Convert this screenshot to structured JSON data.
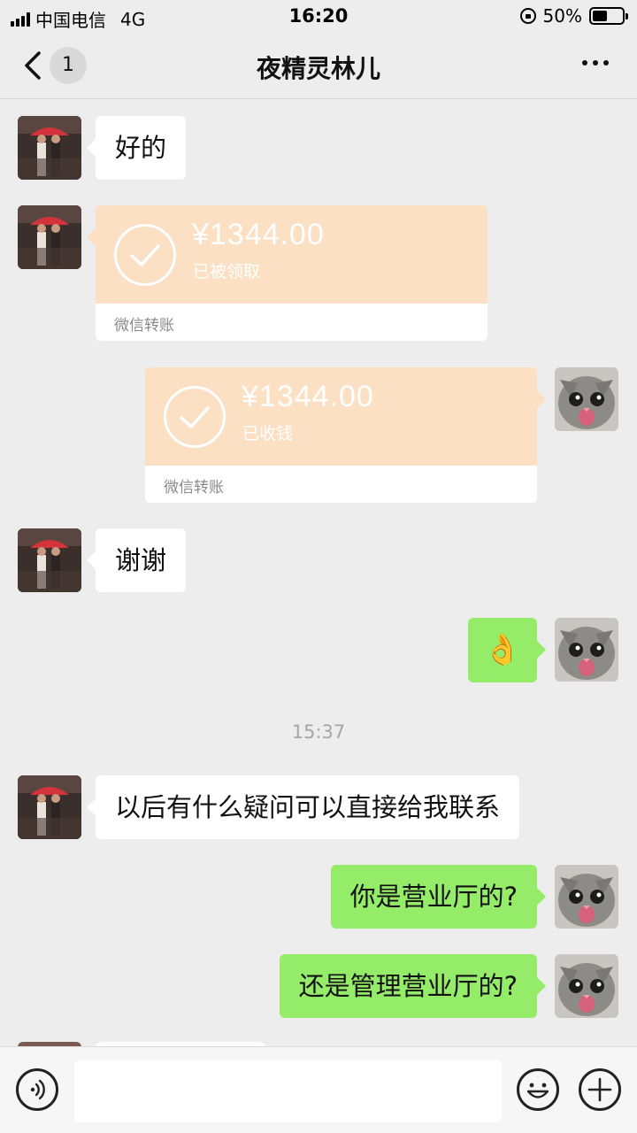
{
  "status_bar": {
    "carrier": "中国电信",
    "network": "4G",
    "time": "16:20",
    "battery_percent": "50%",
    "battery_level": 0.5
  },
  "nav": {
    "back_icon": "chevron-left-icon",
    "unread_count": "1",
    "title": "夜精灵林儿",
    "more_icon": "more-dots-icon"
  },
  "messages": [
    {
      "side": "left",
      "type": "text",
      "text": "好的"
    },
    {
      "side": "left",
      "type": "transfer",
      "amount": "¥1344.00",
      "status": "已被领取",
      "label": "微信转账"
    },
    {
      "side": "right",
      "type": "transfer",
      "amount": "¥1344.00",
      "status": "已收钱",
      "label": "微信转账"
    },
    {
      "side": "left",
      "type": "text",
      "text": "谢谢"
    },
    {
      "side": "right",
      "type": "emoji",
      "text": "👌"
    },
    {
      "type": "time",
      "text": "15:37"
    },
    {
      "side": "left",
      "type": "text",
      "text": "以后有什么疑问可以直接给我联系"
    },
    {
      "side": "right",
      "type": "text",
      "text": "你是营业厅的?"
    },
    {
      "side": "right",
      "type": "text",
      "text": "还是管理营业厅的?"
    }
  ],
  "input_bar": {
    "voice_icon": "voice-icon",
    "text_value": "",
    "emoji_icon": "emoji-icon",
    "plus_icon": "plus-icon"
  },
  "colors": {
    "background": "#ededed",
    "own_bubble": "#95ec69",
    "other_bubble": "#ffffff",
    "transfer_card": "#fbe0c4"
  }
}
